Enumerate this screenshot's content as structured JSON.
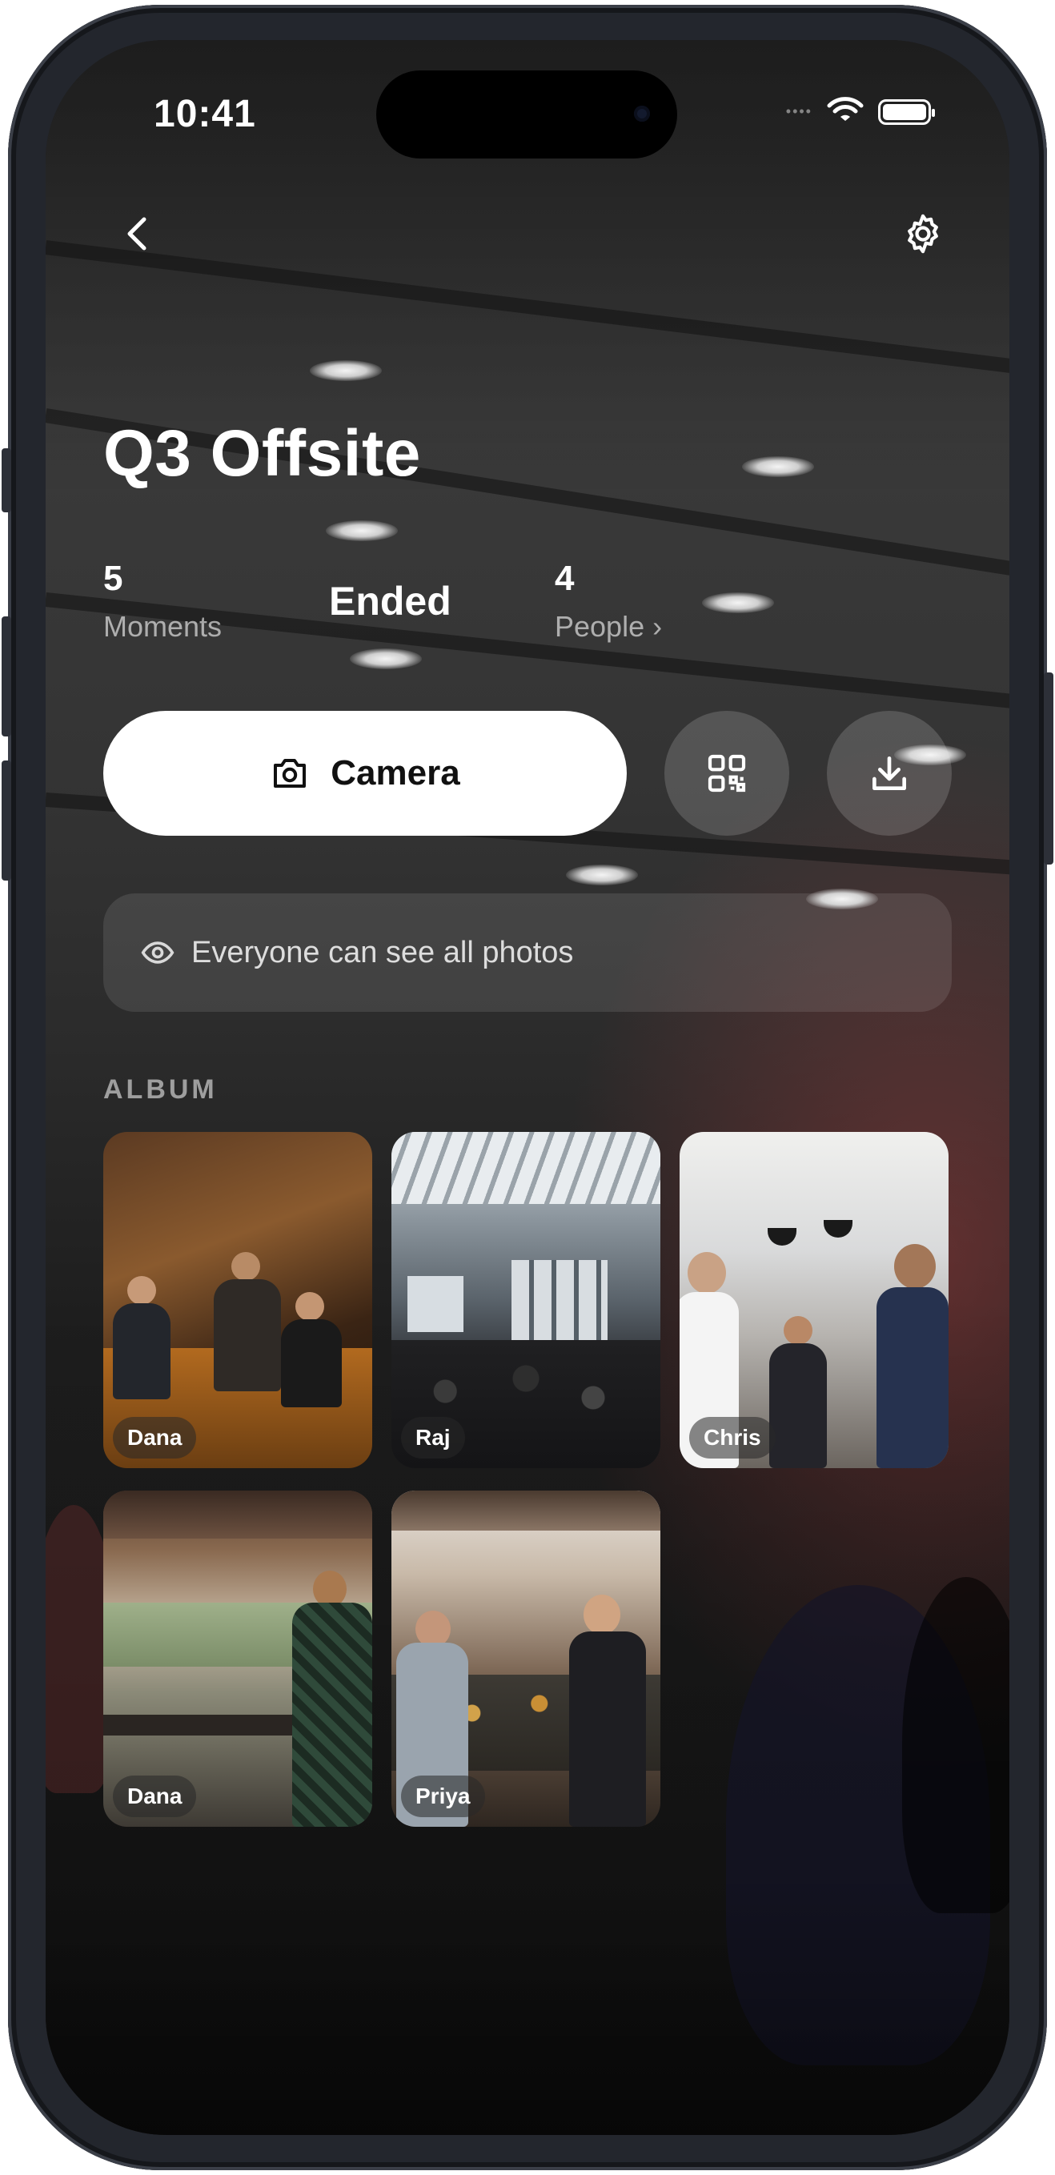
{
  "status_bar": {
    "time": "10:41"
  },
  "event": {
    "title": "Q3 Offsite",
    "stats": {
      "moments_count": "5",
      "moments_label": "Moments",
      "status": "Ended",
      "people_count": "4",
      "people_label": "People ›"
    }
  },
  "actions": {
    "camera_label": "Camera",
    "qr_icon": "qr-code-icon",
    "download_icon": "download-icon"
  },
  "visibility_notice": {
    "icon": "eye-icon",
    "text": "Everyone can see all photos"
  },
  "album": {
    "section_label": "ALBUM",
    "photos": [
      {
        "author": "Dana"
      },
      {
        "author": "Raj"
      },
      {
        "author": "Chris"
      },
      {
        "author": "Dana"
      },
      {
        "author": "Priya"
      }
    ]
  },
  "colors": {
    "primary_button": "#ffffff",
    "text_primary": "#ffffff",
    "text_secondary": "rgba(255,255,255,0.6)"
  }
}
